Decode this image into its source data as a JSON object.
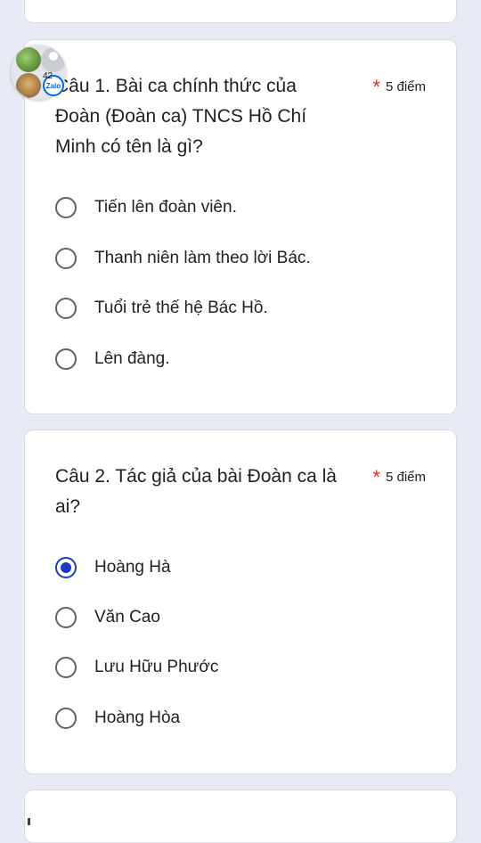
{
  "questions": [
    {
      "title": "Câu 1. Bài ca chính thức của Đoàn (Đoàn ca) TNCS Hồ Chí Minh có tên là gì?",
      "required": "*",
      "points": "5 điểm",
      "options": [
        {
          "label": "Tiến lên đoàn viên.",
          "selected": false
        },
        {
          "label": "Thanh niên làm theo lời Bác.",
          "selected": false
        },
        {
          "label": "Tuổi trẻ thế hệ Bác Hồ.",
          "selected": false
        },
        {
          "label": "Lên đàng.",
          "selected": false
        }
      ]
    },
    {
      "title": "Câu 2. Tác giả của bài Đoàn ca là ai?",
      "required": "*",
      "points": "5 điểm",
      "options": [
        {
          "label": "Hoàng Hà",
          "selected": true
        },
        {
          "label": "Văn Cao",
          "selected": false
        },
        {
          "label": "Lưu Hữu Phước",
          "selected": false
        },
        {
          "label": "Hoàng Hòa",
          "selected": false
        }
      ]
    }
  ],
  "chat_bubble": {
    "count": "42",
    "badge": "Zalo"
  },
  "colors": {
    "background": "#e8eaf6",
    "accent": "#1a3bc9",
    "required": "#d93025"
  }
}
